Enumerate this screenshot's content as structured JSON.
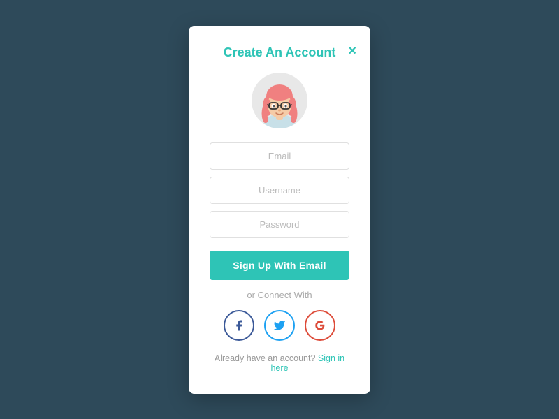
{
  "modal": {
    "title": "Create An Account",
    "close_label": "×",
    "email_placeholder": "Email",
    "username_placeholder": "Username",
    "password_placeholder": "Password",
    "signup_button_label": "Sign Up With Email",
    "or_connect_label": "or Connect With",
    "signin_text": "Already have an account?",
    "signin_link_label": "Sign in here"
  },
  "social": {
    "facebook_label": "f",
    "twitter_label": "t",
    "google_label": "g+"
  },
  "colors": {
    "accent": "#2ec4b6",
    "bg": "#2e4a5a",
    "facebook": "#3b5998",
    "twitter": "#1da1f2",
    "google": "#dd4b39"
  }
}
